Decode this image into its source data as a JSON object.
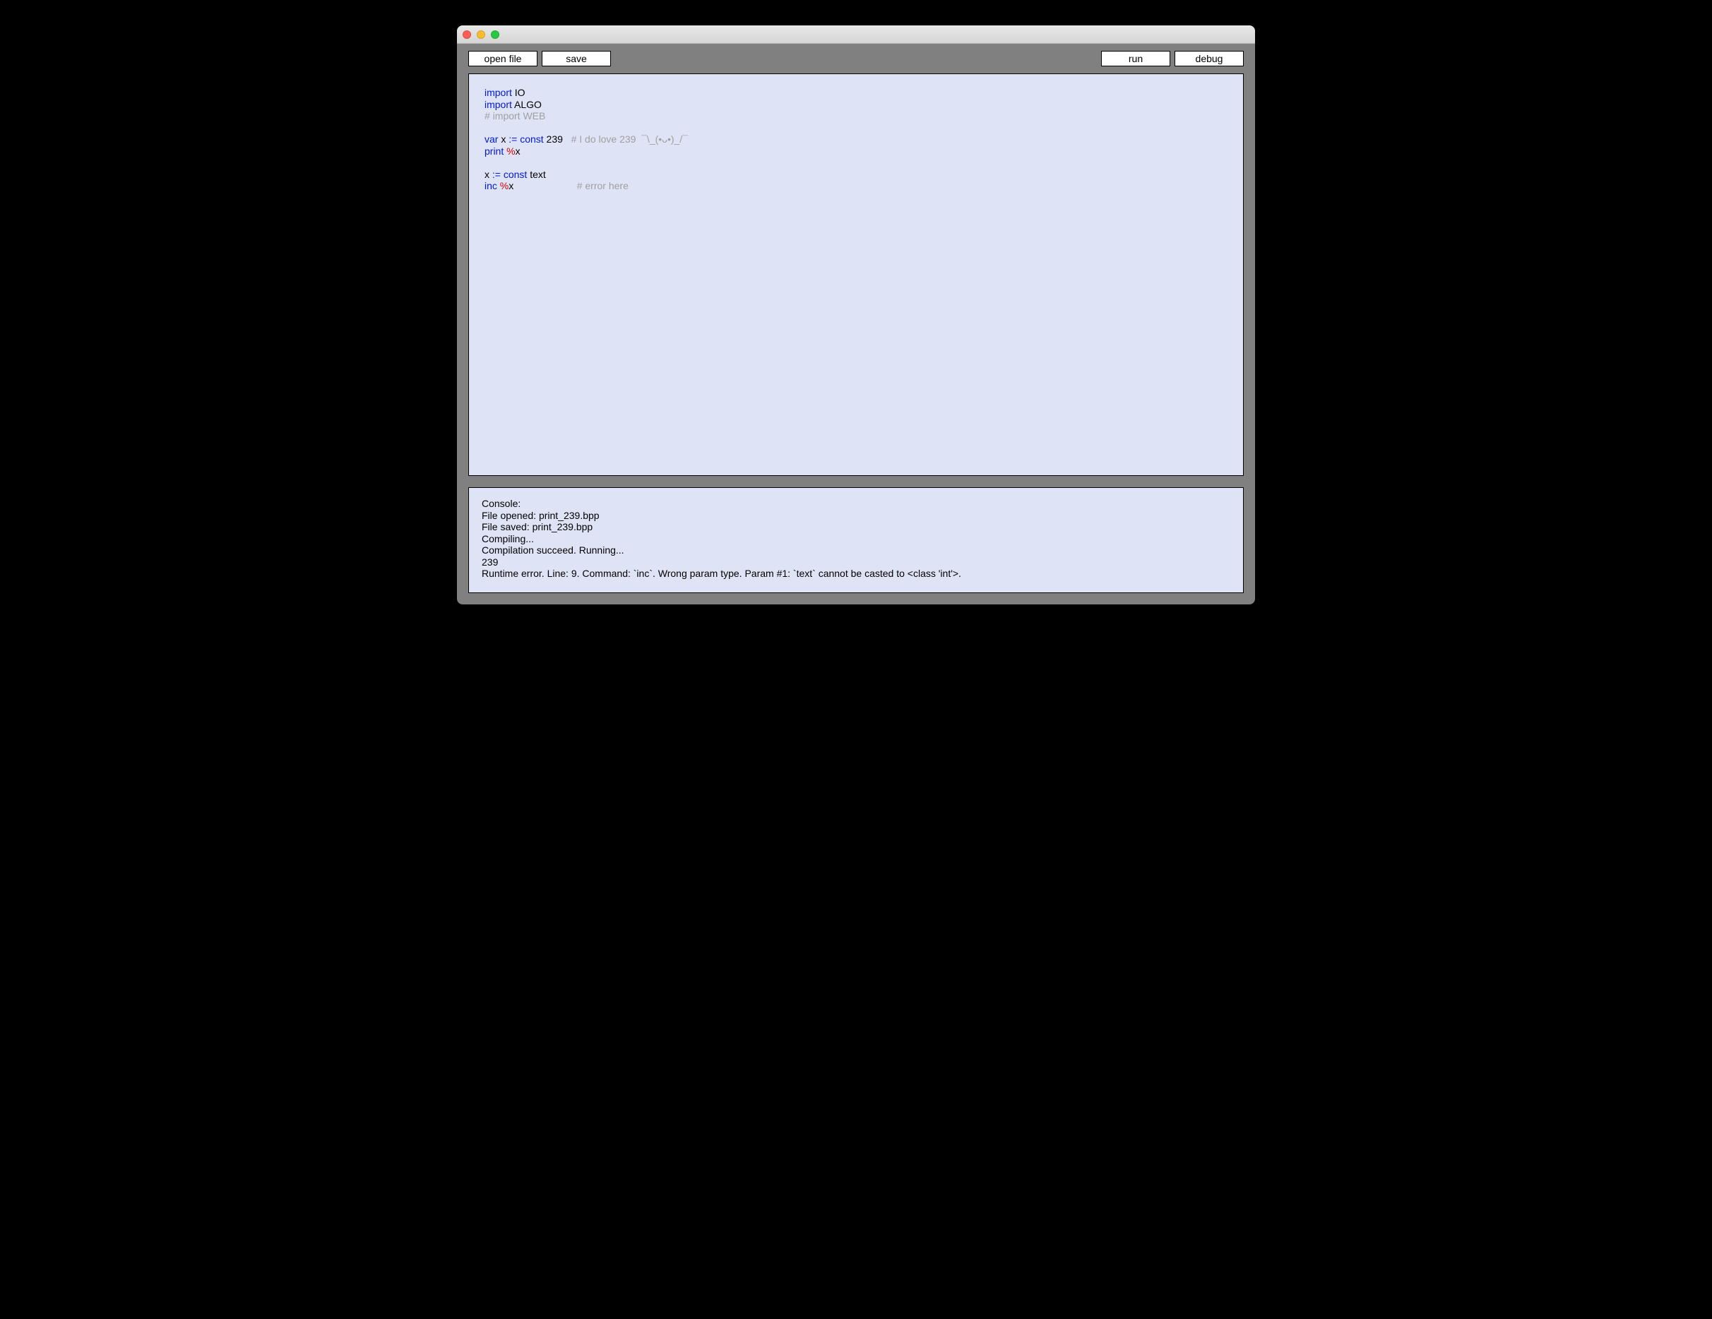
{
  "toolbar": {
    "open_label": "open file",
    "save_label": "save",
    "run_label": "run",
    "debug_label": "debug"
  },
  "editor": {
    "lines": [
      [
        {
          "t": "kw",
          "v": "import"
        },
        {
          "t": "tx",
          "v": " IO"
        }
      ],
      [
        {
          "t": "kw",
          "v": "import"
        },
        {
          "t": "tx",
          "v": " ALGO"
        }
      ],
      [
        {
          "t": "cm",
          "v": "# import WEB"
        }
      ],
      [],
      [
        {
          "t": "kw",
          "v": "var"
        },
        {
          "t": "tx",
          "v": " x "
        },
        {
          "t": "kw",
          "v": ":= const"
        },
        {
          "t": "tx",
          "v": " 239   "
        },
        {
          "t": "cm",
          "v": "# I do love 239  ¯\\_(•ᴗ•)_/¯"
        }
      ],
      [
        {
          "t": "kw",
          "v": "print"
        },
        {
          "t": "tx",
          "v": " "
        },
        {
          "t": "pct",
          "v": "%"
        },
        {
          "t": "tx",
          "v": "x"
        }
      ],
      [],
      [
        {
          "t": "tx",
          "v": "x "
        },
        {
          "t": "kw",
          "v": ":= const"
        },
        {
          "t": "tx",
          "v": " text"
        }
      ],
      [
        {
          "t": "kw",
          "v": "inc"
        },
        {
          "t": "tx",
          "v": " "
        },
        {
          "t": "pct",
          "v": "%"
        },
        {
          "t": "tx",
          "v": "x                       "
        },
        {
          "t": "cm",
          "v": "# error here"
        }
      ]
    ]
  },
  "console": {
    "lines": [
      "Console:",
      "File opened: print_239.bpp",
      "File saved: print_239.bpp",
      "Compiling...",
      "Compilation succeed. Running...",
      "239",
      "Runtime error. Line: 9. Command: `inc`. Wrong param type. Param #1: `text` cannot be casted to <class 'int'>."
    ]
  }
}
